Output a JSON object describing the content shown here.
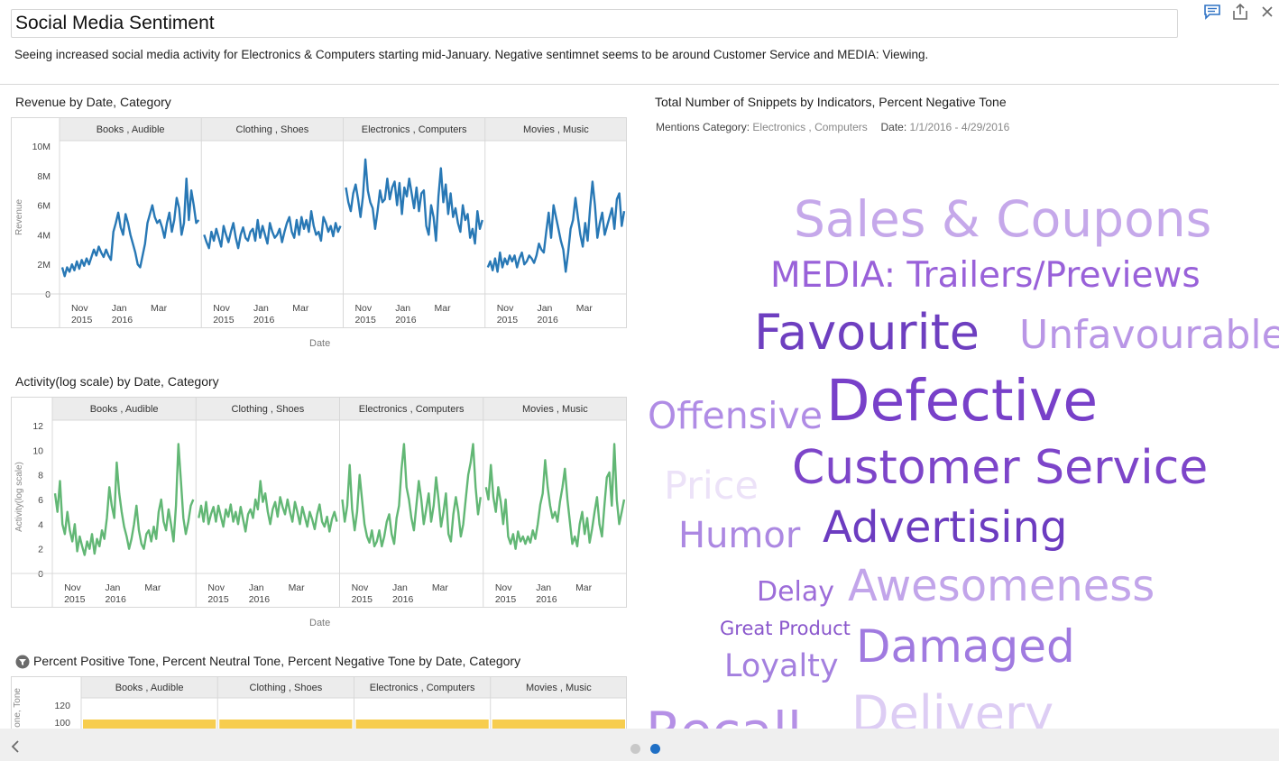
{
  "page": {
    "title": "Social Media Sentiment",
    "description": "Seeing increased social media activity for Electronics & Computers starting mid-January. Negative sentimnet seems to be around Customer Service and MEDIA: Viewing.",
    "icons": [
      "comment-icon",
      "share-icon",
      "close-icon"
    ]
  },
  "charts": {
    "revenue": {
      "title": "Revenue by Date, Category",
      "xaxis_title": "Date",
      "yaxis_title": "Revenue",
      "color": "#2878b5"
    },
    "activity": {
      "title": "Activity(log scale) by Date, Category",
      "xaxis_title": "Date",
      "yaxis_title": "Activity(log scale)",
      "color": "#62b775"
    },
    "tone": {
      "title": "Percent Positive Tone, Percent Neutral Tone, Percent Negative Tone by Date, Category",
      "yaxis_title": "one, one, Tone",
      "color": "#f7cd4e"
    }
  },
  "chart_data": [
    {
      "type": "line",
      "title": "Revenue by Date, Category",
      "xlabel": "Date",
      "ylabel": "Revenue",
      "ylim": [
        0,
        10000000
      ],
      "yticks": [
        "0",
        "2M",
        "4M",
        "6M",
        "8M",
        "10M"
      ],
      "xticks": [
        [
          "Nov",
          "2015"
        ],
        [
          "Jan",
          "2016"
        ],
        [
          "Mar",
          ""
        ]
      ],
      "panels": [
        {
          "name": "Books , Audible",
          "values": [
            1.8,
            1.2,
            1.8,
            1.5,
            2.0,
            1.6,
            2.2,
            1.7,
            2.3,
            1.9,
            2.4,
            2.0,
            2.5,
            3.0,
            2.6,
            3.2,
            2.8,
            2.5,
            3.0,
            2.6,
            2.3,
            4.2,
            4.8,
            5.5,
            4.5,
            4.0,
            5.4,
            4.8,
            4.0,
            3.4,
            2.8,
            2.0,
            1.8,
            2.6,
            3.4,
            4.8,
            5.4,
            6.0,
            5.2,
            4.8,
            5.0,
            4.5,
            3.8,
            4.8,
            5.5,
            4.2,
            5.0,
            6.5,
            5.8,
            4.0,
            4.8,
            7.8,
            5.0,
            7.0,
            6.0,
            4.8,
            5.0
          ]
        },
        {
          "name": "Clothing , Shoes",
          "values": [
            4.0,
            3.5,
            3.1,
            4.2,
            3.6,
            4.4,
            3.8,
            3.2,
            4.6,
            4.0,
            3.5,
            4.2,
            4.8,
            3.8,
            3.1,
            4.0,
            4.5,
            3.8,
            3.6,
            4.2,
            4.4,
            3.6,
            5.0,
            3.8,
            4.6,
            4.0,
            3.4,
            4.8,
            4.2,
            3.8,
            4.0,
            4.4,
            3.5,
            4.2,
            4.8,
            5.2,
            4.2,
            3.8,
            5.0,
            4.0,
            5.2,
            4.4,
            5.0,
            4.2,
            5.6,
            4.6,
            4.0,
            4.2,
            3.6,
            5.2,
            4.8,
            4.2,
            4.6,
            3.9,
            4.8,
            4.2,
            4.6
          ]
        },
        {
          "name": "Electronics , Computers",
          "values": [
            7.2,
            6.2,
            5.6,
            6.8,
            7.4,
            6.4,
            5.2,
            6.6,
            9.1,
            7.0,
            6.2,
            5.8,
            4.4,
            5.6,
            7.0,
            6.2,
            6.4,
            7.8,
            6.4,
            7.2,
            7.6,
            6.0,
            7.5,
            5.4,
            7.2,
            6.6,
            7.8,
            6.8,
            5.8,
            7.2,
            5.6,
            6.8,
            7.0,
            4.6,
            4.0,
            6.0,
            5.2,
            3.6,
            6.6,
            8.5,
            6.2,
            7.4,
            5.4,
            6.8,
            5.2,
            5.8,
            4.8,
            4.2,
            6.0,
            5.0,
            5.4,
            3.8,
            4.4,
            3.4,
            5.6,
            4.4,
            5.0
          ]
        },
        {
          "name": "Movies , Music",
          "values": [
            1.8,
            2.2,
            1.6,
            2.4,
            1.5,
            2.8,
            1.8,
            2.4,
            2.0,
            2.6,
            2.2,
            2.6,
            1.8,
            2.4,
            2.8,
            2.0,
            2.2,
            2.6,
            2.4,
            2.1,
            2.6,
            3.4,
            3.0,
            2.8,
            4.2,
            5.5,
            3.8,
            6.0,
            5.2,
            4.4,
            3.6,
            3.0,
            1.5,
            2.8,
            4.4,
            5.0,
            6.5,
            5.2,
            4.0,
            3.2,
            4.8,
            3.6,
            5.8,
            7.6,
            6.0,
            3.8,
            4.8,
            5.5,
            4.0,
            4.6,
            5.2,
            5.8,
            4.4,
            6.4,
            6.8,
            4.6,
            5.6
          ]
        }
      ]
    },
    {
      "type": "line",
      "title": "Activity(log scale) by Date, Category",
      "xlabel": "Date",
      "ylabel": "Activity(log scale)",
      "ylim": [
        0,
        12
      ],
      "yticks": [
        "0",
        "2",
        "4",
        "6",
        "8",
        "10",
        "12"
      ],
      "xticks": [
        [
          "Nov",
          "2015"
        ],
        [
          "Jan",
          "2016"
        ],
        [
          "Mar",
          ""
        ]
      ],
      "panels": [
        {
          "name": "Books , Audible",
          "values": [
            6.5,
            5.0,
            7.5,
            4.0,
            3.2,
            5.0,
            3.5,
            2.6,
            4.0,
            1.8,
            3.0,
            2.2,
            1.5,
            2.6,
            2.0,
            3.2,
            1.6,
            2.8,
            2.2,
            3.5,
            2.8,
            4.5,
            7.0,
            5.5,
            4.5,
            9.0,
            6.5,
            5.0,
            3.8,
            3.0,
            2.0,
            2.8,
            4.0,
            5.5,
            3.5,
            2.4,
            2.0,
            3.2,
            3.5,
            2.6,
            3.8,
            2.8,
            5.0,
            6.0,
            4.2,
            3.5,
            5.2,
            4.0,
            2.6,
            5.5,
            10.5,
            7.5,
            4.5,
            3.2,
            4.2,
            5.5,
            6.0
          ]
        },
        {
          "name": "Clothing , Shoes",
          "values": [
            4.5,
            5.5,
            4.2,
            5.8,
            4.0,
            4.8,
            5.4,
            4.2,
            5.5,
            4.6,
            3.8,
            5.2,
            4.6,
            5.6,
            4.2,
            5.0,
            4.0,
            5.4,
            4.4,
            3.4,
            4.8,
            5.2,
            4.5,
            6.0,
            5.2,
            7.5,
            5.8,
            6.5,
            5.0,
            4.0,
            5.2,
            5.8,
            4.6,
            6.2,
            5.4,
            4.8,
            6.0,
            5.0,
            4.2,
            5.8,
            5.0,
            4.0,
            5.4,
            4.6,
            3.8,
            5.0,
            4.4,
            3.6,
            4.8,
            5.6,
            4.2,
            3.8,
            4.6,
            3.4,
            4.4,
            5.0,
            4.2
          ]
        },
        {
          "name": "Electronics , Computers",
          "values": [
            6.0,
            4.2,
            5.5,
            8.8,
            5.2,
            3.5,
            5.0,
            8.0,
            6.0,
            4.0,
            3.0,
            2.5,
            3.5,
            2.2,
            2.6,
            3.5,
            2.2,
            3.0,
            4.2,
            4.8,
            3.2,
            2.4,
            4.5,
            5.5,
            8.5,
            10.5,
            7.0,
            6.0,
            4.5,
            3.5,
            5.5,
            7.5,
            6.0,
            4.0,
            5.2,
            6.5,
            4.2,
            5.5,
            7.8,
            6.0,
            3.8,
            5.0,
            6.5,
            3.2,
            2.6,
            4.8,
            6.2,
            5.0,
            3.0,
            4.0,
            6.0,
            8.0,
            9.0,
            10.5,
            7.0,
            4.8,
            6.2
          ]
        },
        {
          "name": "Movies , Music",
          "values": [
            7.0,
            6.0,
            8.8,
            6.2,
            5.0,
            7.0,
            5.8,
            4.0,
            6.0,
            3.0,
            2.4,
            3.2,
            2.0,
            3.4,
            2.6,
            3.0,
            2.4,
            3.0,
            2.5,
            3.5,
            2.8,
            4.0,
            5.6,
            6.5,
            9.2,
            7.0,
            5.5,
            4.5,
            5.0,
            4.2,
            5.8,
            7.0,
            8.5,
            6.0,
            4.2,
            2.4,
            3.0,
            2.2,
            4.0,
            5.0,
            3.2,
            4.5,
            2.5,
            3.6,
            5.0,
            6.2,
            4.0,
            3.0,
            5.5,
            7.8,
            8.2,
            5.5,
            10.5,
            6.0,
            4.0,
            5.0,
            6.0
          ]
        }
      ]
    },
    {
      "type": "bar",
      "title": "Percent Positive Tone, Percent Neutral Tone, Percent Negative Tone by Date, Category",
      "ylabel": "one, one, Tone",
      "yticks": [
        "100",
        "120"
      ],
      "panels": [
        {
          "name": "Books , Audible",
          "values": [
            100
          ]
        },
        {
          "name": "Clothing , Shoes",
          "values": [
            100
          ]
        },
        {
          "name": "Electronics , Computers",
          "values": [
            100
          ]
        },
        {
          "name": "Movies , Music",
          "values": [
            100
          ]
        }
      ]
    }
  ],
  "wordcloud": {
    "title": "Total Number of Snippets by Indicators, Percent Negative Tone",
    "filter_mentions_label": "Mentions Category:",
    "filter_mentions_value": "Electronics , Computers",
    "filter_date_label": "Date:",
    "filter_date_value": "1/1/2016 - 4/29/2016",
    "words": [
      {
        "text": "Sales & Coupons",
        "color": "#c5a8ea"
      },
      {
        "text": "MEDIA: Trailers/Previews",
        "color": "#9961d9"
      },
      {
        "text": "Favourite",
        "color": "#6e3fc0"
      },
      {
        "text": "Unfavourable",
        "color": "#b996e6"
      },
      {
        "text": "Offensive",
        "color": "#b08ce5"
      },
      {
        "text": "Defective",
        "color": "#7840c9"
      },
      {
        "text": "Customer Service",
        "color": "#7d45c9"
      },
      {
        "text": "Price",
        "color": "#ece2f8"
      },
      {
        "text": "Humor",
        "color": "#ac88e2"
      },
      {
        "text": "Advertising",
        "color": "#6c3cc0"
      },
      {
        "text": "Delay",
        "color": "#9d6dd9"
      },
      {
        "text": "Awesomeness",
        "color": "#c2a5ea"
      },
      {
        "text": "Great Product",
        "color": "#8a57cc"
      },
      {
        "text": "Damaged",
        "color": "#a07ae0"
      },
      {
        "text": "Loyalty",
        "color": "#a480df"
      },
      {
        "text": "Delivery",
        "color": "#ddcdf4"
      },
      {
        "text": "Recall",
        "color": "#b590e6"
      }
    ]
  },
  "footer": {
    "page_dots": 2,
    "active_dot": 2
  },
  "colors": {
    "accent": "#2878b5",
    "dot_active": "#1f6fc5",
    "dot_inactive": "#c8c8c8",
    "grid": "#d8d8d8",
    "header_bg": "#ececec"
  }
}
